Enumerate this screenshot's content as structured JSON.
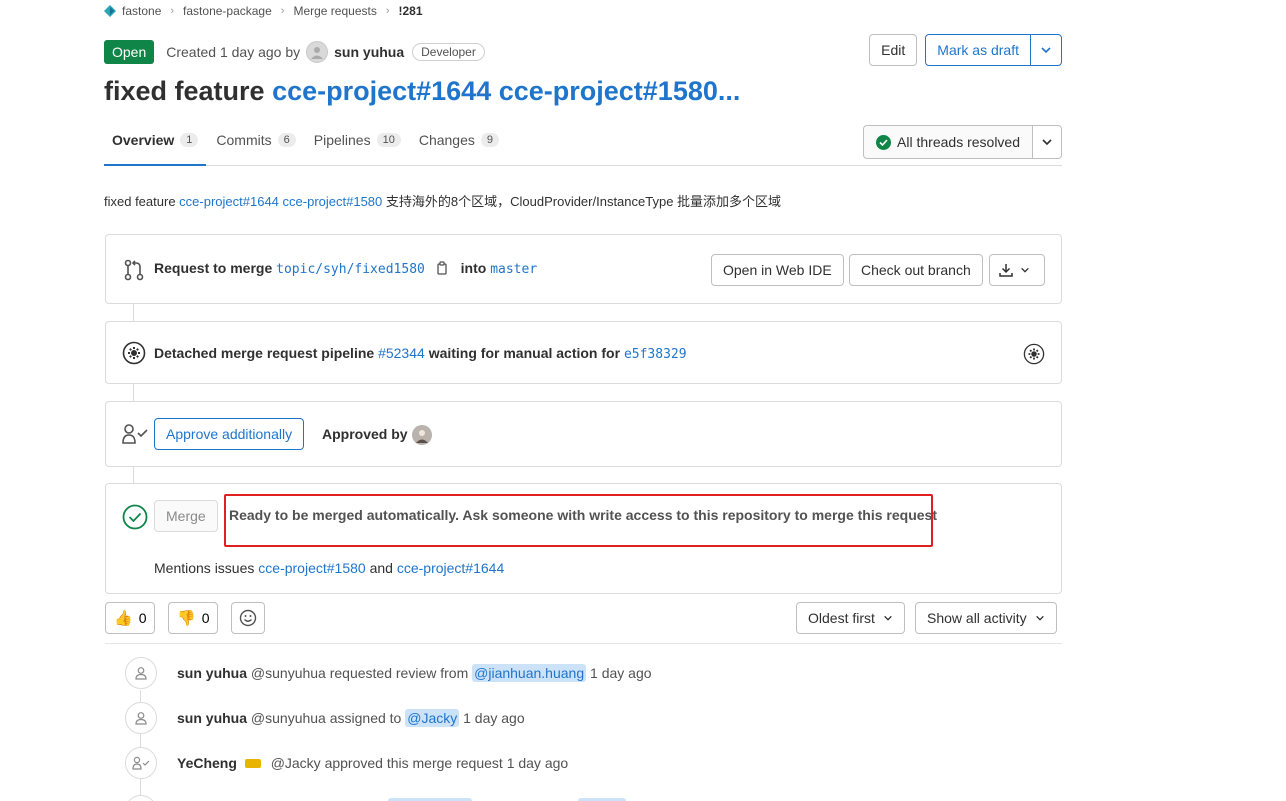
{
  "breadcrumb": {
    "items": [
      "fastone",
      "fastone-package",
      "Merge requests",
      "!281"
    ]
  },
  "header": {
    "status": "Open",
    "created_prefix": "Created 1 day ago by",
    "author": "sun yuhua",
    "role": "Developer",
    "edit_label": "Edit",
    "draft_label": "Mark as draft"
  },
  "title": {
    "prefix": "fixed feature",
    "link1": "cce-project#1644",
    "link2": "cce-project#1580..."
  },
  "tabs": [
    {
      "label": "Overview",
      "count": "1"
    },
    {
      "label": "Commits",
      "count": "6"
    },
    {
      "label": "Pipelines",
      "count": "10"
    },
    {
      "label": "Changes",
      "count": "9"
    }
  ],
  "threads_label": "All threads resolved",
  "description": {
    "prefix": "fixed feature",
    "link1": "cce-project#1644",
    "link2": "cce-project#1580",
    "suffix": "支持海外的8个区域，CloudProvider/InstanceType 批量添加多个区域"
  },
  "merge_request": {
    "label": "Request to merge",
    "source_branch": "topic/syh/fixed1580",
    "into": "into",
    "target_branch": "master",
    "web_ide_label": "Open in Web IDE",
    "checkout_label": "Check out branch"
  },
  "pipeline": {
    "prefix": "Detached merge request pipeline",
    "pipeline_id": "#52344",
    "middle": "waiting for manual action for",
    "commit": "e5f38329"
  },
  "approval": {
    "approve_label": "Approve additionally",
    "approved_by": "Approved by"
  },
  "merge": {
    "button_label": "Merge",
    "message": "Ready to be merged automatically. Ask someone with write access to this repository to merge this request",
    "mentions_prefix": "Mentions issues",
    "issue1": "cce-project#1580",
    "and": "and",
    "issue2": "cce-project#1644"
  },
  "reactions": {
    "thumbs_up": "0",
    "thumbs_down": "0"
  },
  "sort_label": "Oldest first",
  "filter_label": "Show all activity",
  "activity": [
    {
      "author": "sun yuhua",
      "handle": "@sunyuhua",
      "action": "requested review from",
      "mention": "@jianhuan.huang",
      "time": "1 day ago"
    },
    {
      "author": "sun yuhua",
      "handle": "@sunyuhua",
      "action": "assigned to",
      "mention": "@Jacky",
      "time": "1 day ago"
    },
    {
      "author": "YeCheng",
      "handle": "@Jacky",
      "action": "approved this merge request",
      "mention": "",
      "time": "1 day ago"
    }
  ],
  "colors": {
    "accent": "#1f75cb",
    "success": "#108548",
    "highlight": "#e02020"
  }
}
